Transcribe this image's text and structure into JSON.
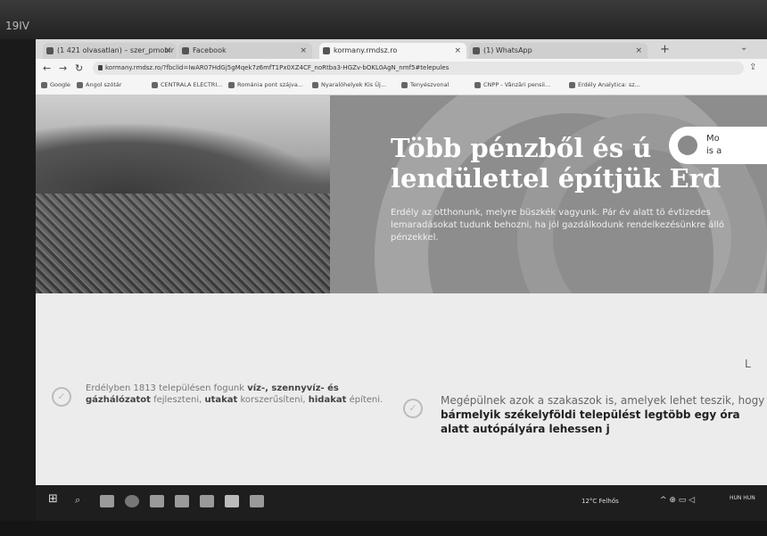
{
  "bezel": {
    "label": "19IV"
  },
  "browser": {
    "tabs": [
      {
        "label": "(1 421 olvasatlan) – szer_pmobir",
        "active": false
      },
      {
        "label": "Facebook",
        "active": false
      },
      {
        "label": "kormany.rmdsz.ro",
        "active": true
      },
      {
        "label": "(1) WhatsApp",
        "active": false
      }
    ],
    "new_tab": "+",
    "address": "kormany.rmdsz.ro/?fbclid=IwAR07HdGj5gMqek7z6mfT1Px0XZ4CF_noRtba3-HGZv-bOKL0AgN_nmf5#telepules",
    "bookmarks": [
      "Google",
      "Angol szótár",
      "CENTRALA ELECTRI...",
      "Románia pont szájva...",
      "Nyaralóhelyek Kis Új...",
      "Tenyészvonal",
      "CNPP - Vânzări pensii...",
      "Erdély Analytica: sz..."
    ]
  },
  "hero": {
    "title": "Több pénzből és ú\nlendülettel építjük Erd",
    "text": "Erdély az otthonunk, melyre büszkék vagyunk. Pár év alatt tö évtizedes lemaradásokat tudunk behozni, ha jól gazdálkodunk rendelkezésünkre álló pénzekkel.",
    "chat_text": "Mo\nis a"
  },
  "features": [
    {
      "parts": [
        {
          "t": "Erdélyben 1813 településen fogunk ",
          "b": false
        },
        {
          "t": "víz-, szennyvíz- és gázhálózatot",
          "b": true
        },
        {
          "t": " fejleszteni, ",
          "b": false
        },
        {
          "t": "utakat",
          "b": true
        },
        {
          "t": " korszerűsíteni, ",
          "b": false
        },
        {
          "t": "hidakat",
          "b": true
        },
        {
          "t": " építeni.",
          "b": false
        }
      ]
    },
    {
      "parts": [
        {
          "t": "Megépülnek azok a szakaszok is, amelyek lehet teszik, hogy ",
          "b": false
        },
        {
          "t": "bármelyik székelyföldi települést",
          "b": true
        },
        {
          "t": " legtöbb egy óra alatt autópályára lehessen j",
          "b": true
        }
      ]
    }
  ],
  "side_letter": "L",
  "taskbar": {
    "weather": "12°C Felhős",
    "tray": "^ ⊕ ▭ ◁",
    "lang": "HUN\nHUN"
  }
}
